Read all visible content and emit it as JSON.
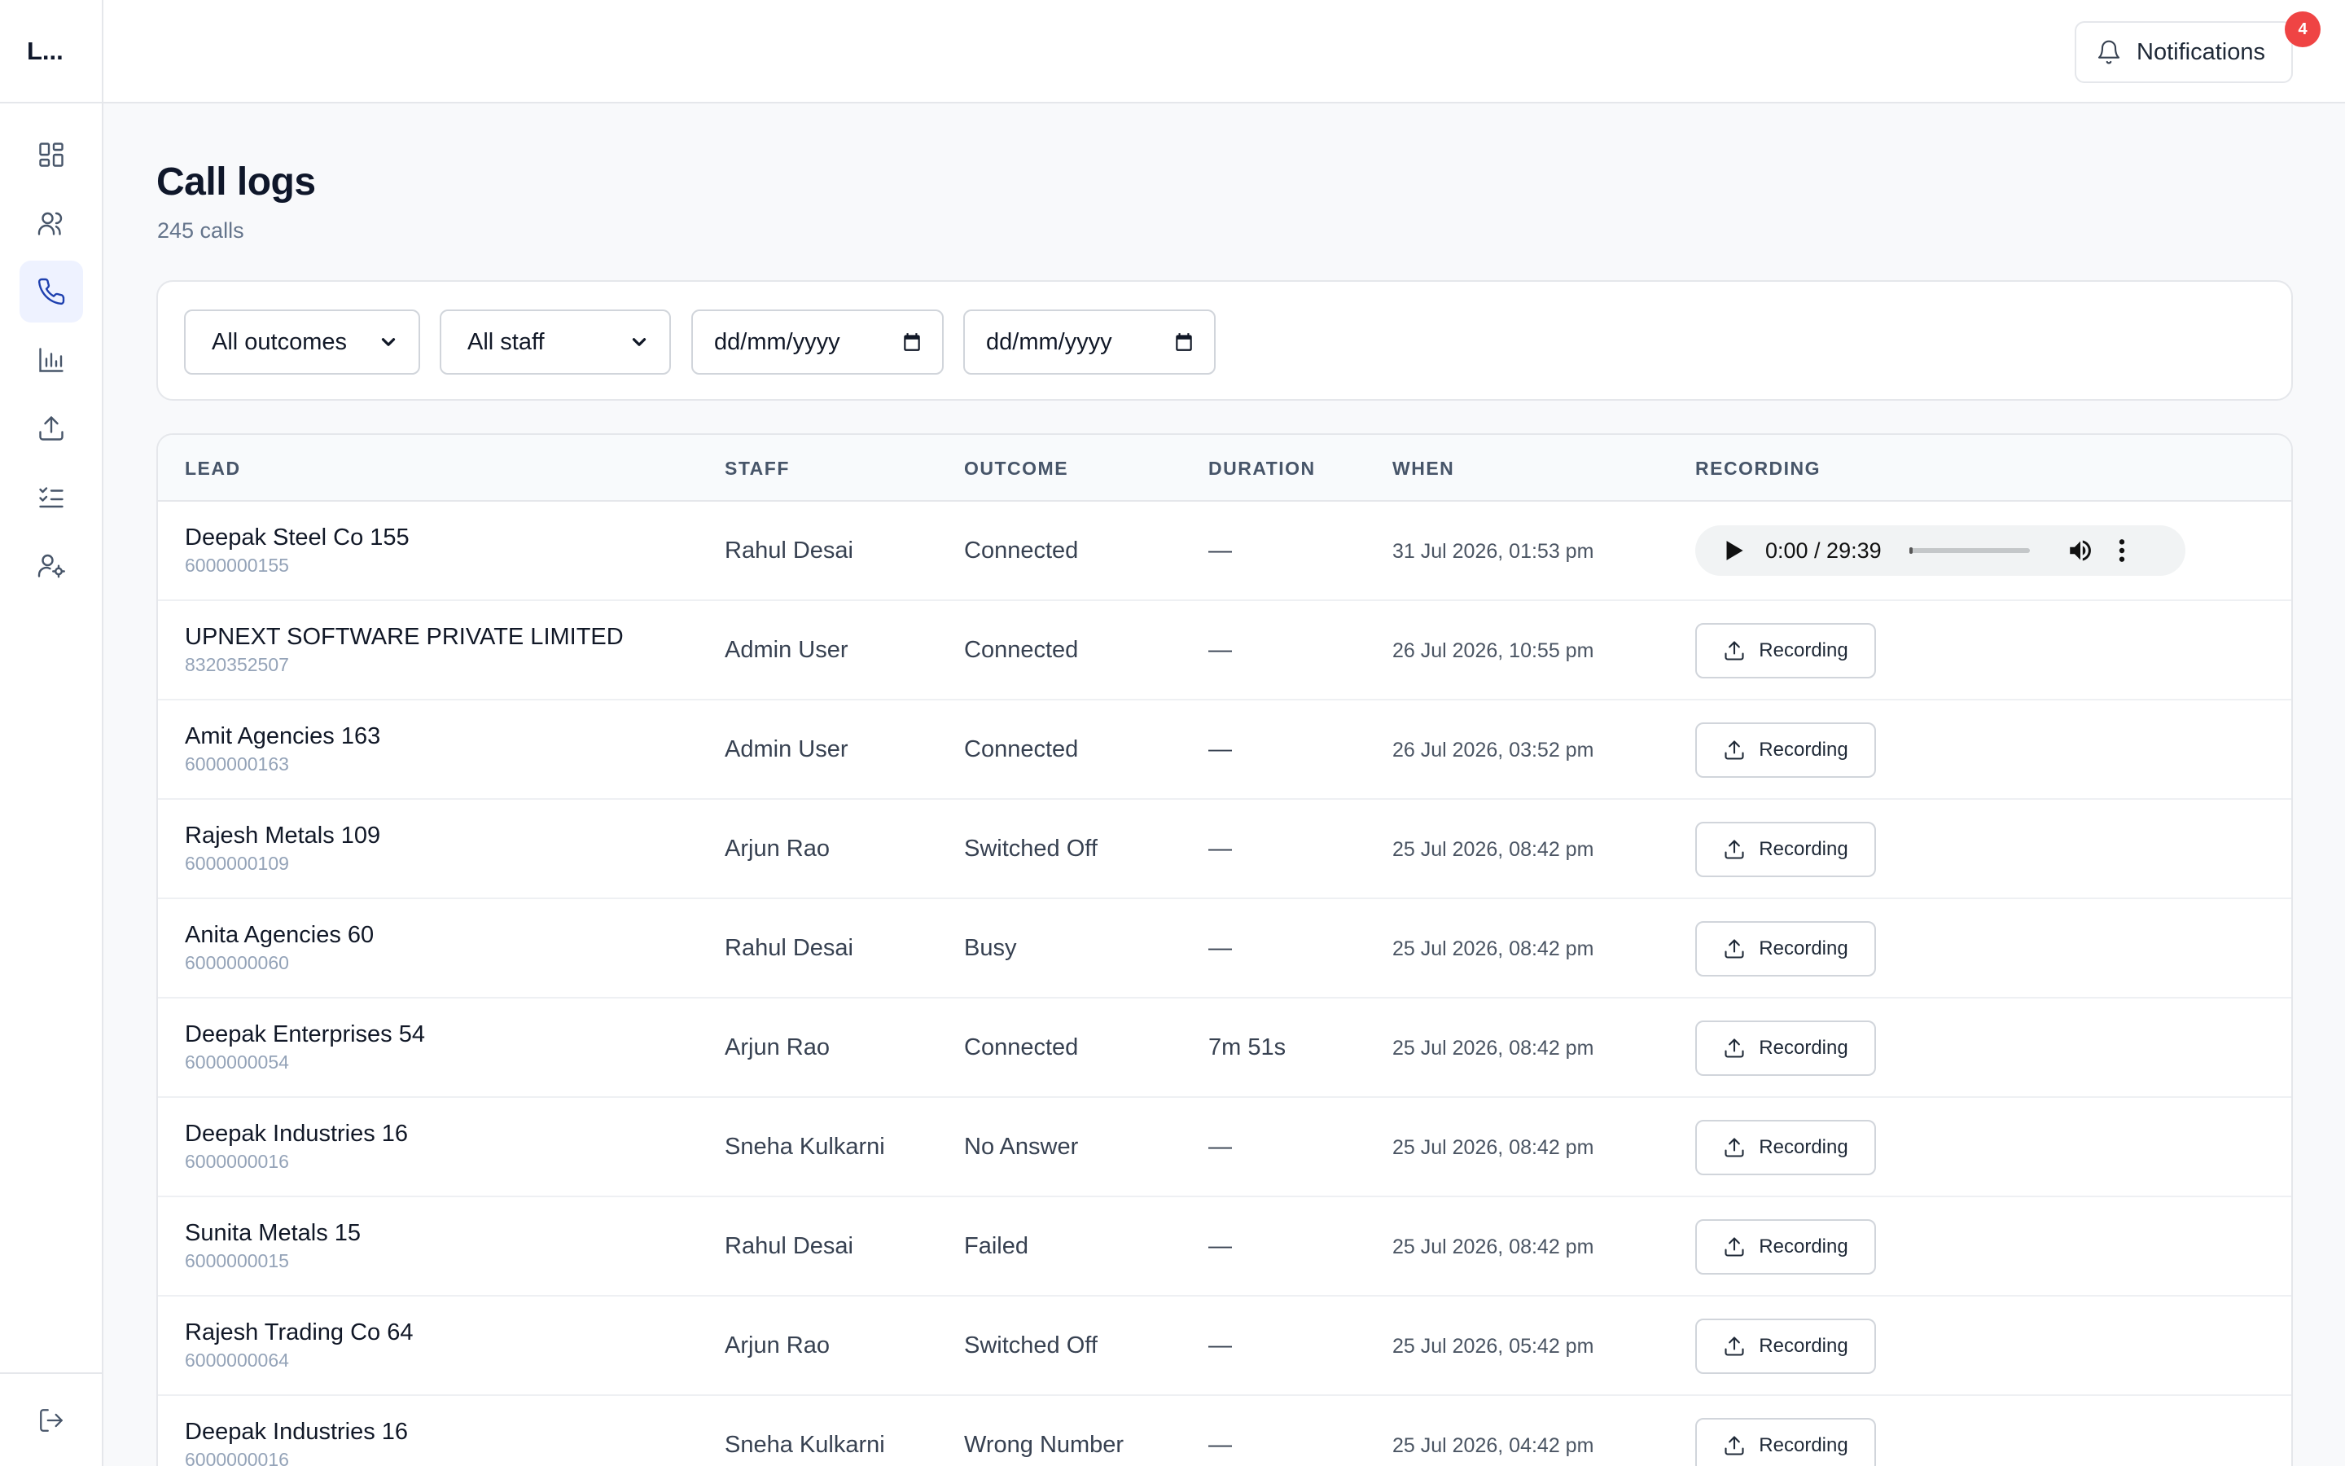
{
  "app": {
    "brand": "L..."
  },
  "sidebar": {
    "items": [
      {
        "icon": "dashboard-icon",
        "active": false
      },
      {
        "icon": "users-icon",
        "active": false
      },
      {
        "icon": "phone-icon",
        "active": true
      },
      {
        "icon": "bar-chart-icon",
        "active": false
      },
      {
        "icon": "upload-icon",
        "active": false
      },
      {
        "icon": "checklist-icon",
        "active": false
      },
      {
        "icon": "user-settings-icon",
        "active": false
      }
    ],
    "logout_icon": "logout-icon"
  },
  "topbar": {
    "notifications_label": "Notifications",
    "notifications_count": "4"
  },
  "page": {
    "title": "Call logs",
    "subtitle": "245 calls"
  },
  "filters": {
    "outcome": "All outcomes",
    "staff": "All staff",
    "date_from_placeholder": "dd/mm/yyyy",
    "date_to_placeholder": "dd/mm/yyyy"
  },
  "table": {
    "columns": [
      "LEAD",
      "STAFF",
      "OUTCOME",
      "DURATION",
      "WHEN",
      "RECORDING"
    ],
    "recording_button_label": "Recording",
    "audio_time": "0:00 / 29:39",
    "rows": [
      {
        "lead": "Deepak Steel Co 155",
        "phone": "6000000155",
        "staff": "Rahul Desai",
        "outcome": "Connected",
        "duration": "—",
        "when": "31 Jul 2026, 01:53 pm",
        "has_audio": true
      },
      {
        "lead": "UPNEXT SOFTWARE PRIVATE LIMITED",
        "phone": "8320352507",
        "staff": "Admin User",
        "outcome": "Connected",
        "duration": "—",
        "when": "26 Jul 2026, 10:55 pm",
        "has_audio": false
      },
      {
        "lead": "Amit Agencies 163",
        "phone": "6000000163",
        "staff": "Admin User",
        "outcome": "Connected",
        "duration": "—",
        "when": "26 Jul 2026, 03:52 pm",
        "has_audio": false
      },
      {
        "lead": "Rajesh Metals 109",
        "phone": "6000000109",
        "staff": "Arjun Rao",
        "outcome": "Switched Off",
        "duration": "—",
        "when": "25 Jul 2026, 08:42 pm",
        "has_audio": false
      },
      {
        "lead": "Anita Agencies 60",
        "phone": "6000000060",
        "staff": "Rahul Desai",
        "outcome": "Busy",
        "duration": "—",
        "when": "25 Jul 2026, 08:42 pm",
        "has_audio": false
      },
      {
        "lead": "Deepak Enterprises 54",
        "phone": "6000000054",
        "staff": "Arjun Rao",
        "outcome": "Connected",
        "duration": "7m 51s",
        "when": "25 Jul 2026, 08:42 pm",
        "has_audio": false
      },
      {
        "lead": "Deepak Industries 16",
        "phone": "6000000016",
        "staff": "Sneha Kulkarni",
        "outcome": "No Answer",
        "duration": "—",
        "when": "25 Jul 2026, 08:42 pm",
        "has_audio": false
      },
      {
        "lead": "Sunita Metals 15",
        "phone": "6000000015",
        "staff": "Rahul Desai",
        "outcome": "Failed",
        "duration": "—",
        "when": "25 Jul 2026, 08:42 pm",
        "has_audio": false
      },
      {
        "lead": "Rajesh Trading Co 64",
        "phone": "6000000064",
        "staff": "Arjun Rao",
        "outcome": "Switched Off",
        "duration": "—",
        "when": "25 Jul 2026, 05:42 pm",
        "has_audio": false
      },
      {
        "lead": "Deepak Industries 16",
        "phone": "6000000016",
        "staff": "Sneha Kulkarni",
        "outcome": "Wrong Number",
        "duration": "—",
        "when": "25 Jul 2026, 04:42 pm",
        "has_audio": false
      }
    ]
  }
}
